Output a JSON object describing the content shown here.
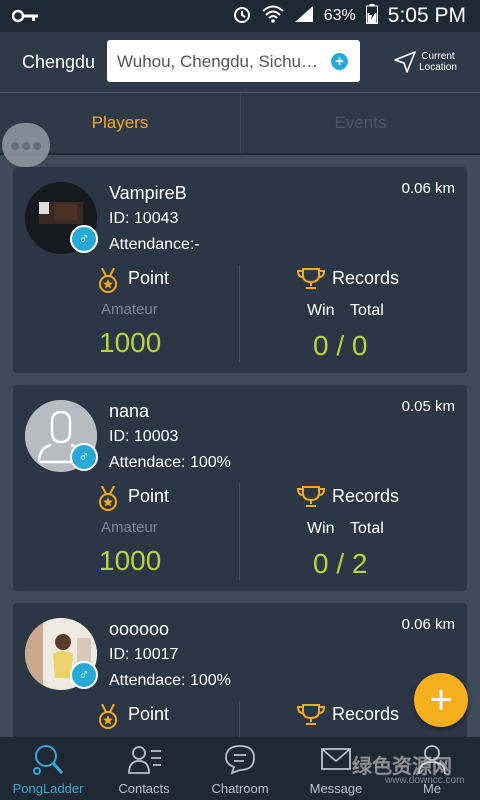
{
  "status_bar": {
    "battery": "63%",
    "time": "5:05 PM"
  },
  "header": {
    "city": "Chengdu",
    "search_value": "Wuhou, Chengdu, Sichu…",
    "location_label_1": "Current",
    "location_label_2": "Location"
  },
  "tabs": [
    {
      "label": "Players"
    },
    {
      "label": "Events"
    }
  ],
  "cards": [
    {
      "name": "VampireB",
      "id": "ID: 10043",
      "attendance": "Attendance:-",
      "distance": "0.06 km",
      "point_label": "Point",
      "level": "Amateur",
      "score": "1000",
      "records_label": "Records",
      "win_label": "Win",
      "total_label": "Total",
      "win_total": "0 / 0"
    },
    {
      "name": "nana",
      "id": "ID: 10003",
      "attendance": "Attendace: 100%",
      "distance": "0.05 km",
      "point_label": "Point",
      "level": "Amateur",
      "score": "1000",
      "records_label": "Records",
      "win_label": "Win",
      "total_label": "Total",
      "win_total": "0 / 2"
    },
    {
      "name": "oooooo",
      "id": "ID: 10017",
      "attendance": "Attendace: 100%",
      "distance": "0.06 km",
      "point_label": "Point",
      "records_label": "Records"
    }
  ],
  "bottom_nav": [
    {
      "label": "PongLadder",
      "icon": "ping-pong-icon",
      "active": true
    },
    {
      "label": "Contacts",
      "icon": "contacts-icon"
    },
    {
      "label": "Chatroom",
      "icon": "chat-bubble-icon"
    },
    {
      "label": "Message",
      "icon": "envelope-icon"
    },
    {
      "label": "Me",
      "icon": "person-icon"
    }
  ],
  "watermark": {
    "text": "绿色资源网",
    "url": "www.downcc.com"
  },
  "colors": {
    "accent_orange": "#f6a821",
    "score_green": "#b9d23d",
    "gender_blue": "#29a9d6",
    "card_bg": "#2b3744"
  }
}
